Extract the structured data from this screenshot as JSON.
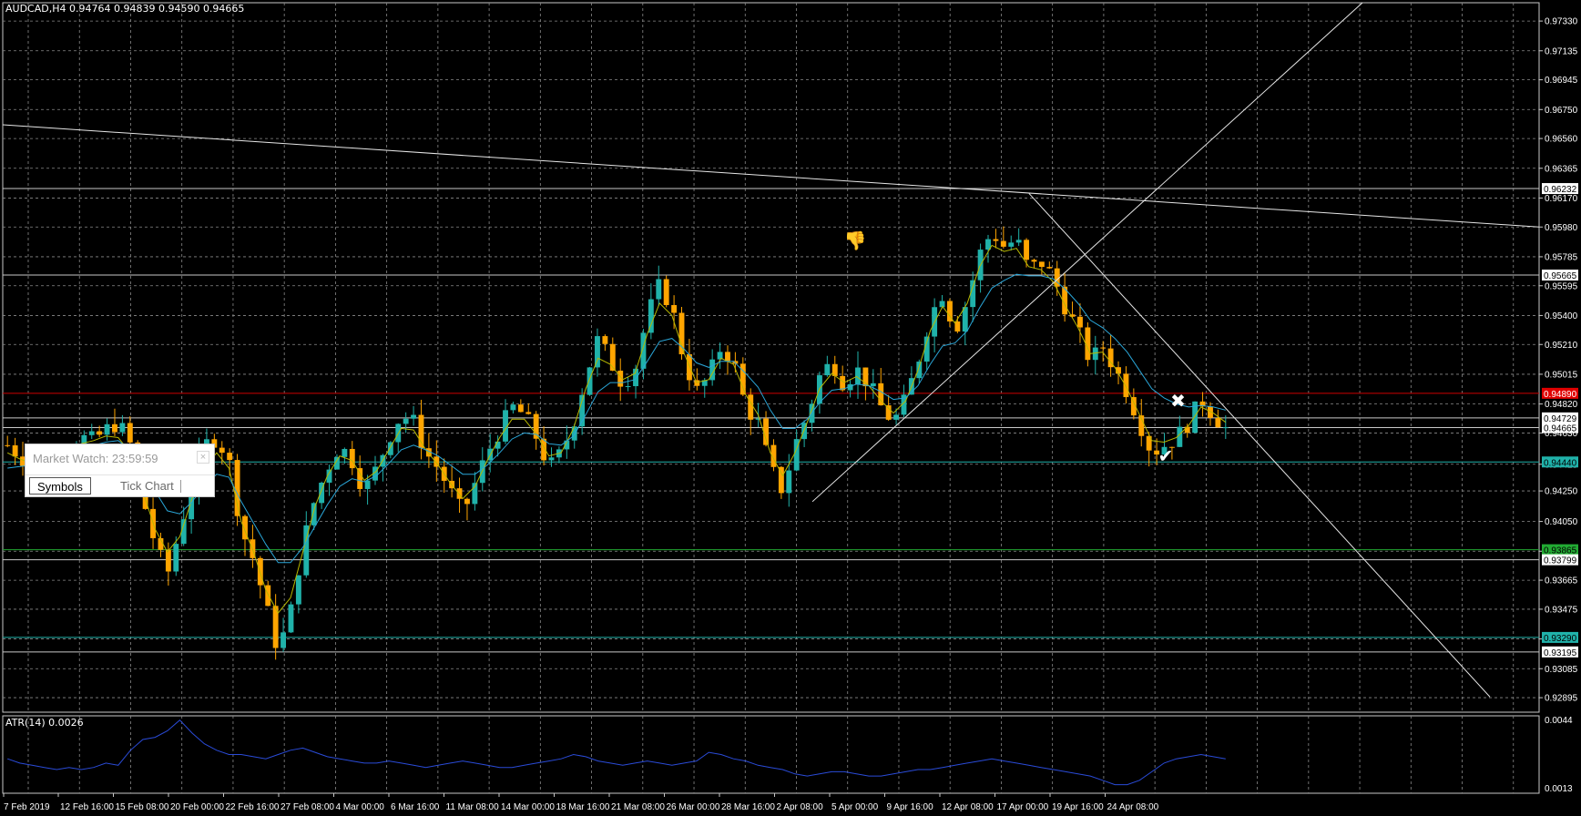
{
  "chart_header": {
    "symbol_info": "AUDCAD,H4  0.94764 0.94839 0.94590 0.94665"
  },
  "indicator": {
    "label": "ATR(14) 0.0026",
    "axis_labels": [
      "0.0044",
      "0.0013"
    ]
  },
  "market_watch": {
    "title": "Market Watch: 23:59:59",
    "close_glyph": "×",
    "tabs": [
      "Symbols",
      "Tick Chart"
    ],
    "active_tab": "Symbols"
  },
  "colors": {
    "background": "#000000",
    "grid": "#8a8a8a",
    "bull_candle": "#20b2aa",
    "bear_candle": "#ffa500",
    "ma_fast": "#b8b800",
    "ma_slow": "#2aa6d8",
    "atr_line": "#2a4bd8",
    "resistance_line": "#cc0000",
    "support_line": "#20b2aa",
    "green_level": "#22aa33"
  },
  "chart_data": {
    "type": "candlestick",
    "symbol": "AUDCAD",
    "timeframe": "H4",
    "ylim": [
      0.928,
      0.9745
    ],
    "price_ticks": [
      "0.97330",
      "0.97135",
      "0.96945",
      "0.96750",
      "0.96560",
      "0.96365",
      "0.96170",
      "0.95980",
      "0.95785",
      "0.95595",
      "0.95400",
      "0.95210",
      "0.95015",
      "0.94820",
      "0.94630",
      "0.94425",
      "0.94250",
      "0.94050",
      "0.93855",
      "0.93665",
      "0.93475",
      "0.93280",
      "0.93085",
      "0.92895"
    ],
    "time_labels": [
      "7 Feb 2019",
      "12 Feb 16:00",
      "15 Feb 08:00",
      "20 Feb 00:00",
      "22 Feb 16:00",
      "27 Feb 08:00",
      "4 Mar 00:00",
      "6 Mar 16:00",
      "11 Mar 08:00",
      "14 Mar 00:00",
      "18 Mar 16:00",
      "21 Mar 08:00",
      "26 Mar 00:00",
      "28 Mar 16:00",
      "2 Apr 08:00",
      "5 Apr 00:00",
      "9 Apr 16:00",
      "12 Apr 08:00",
      "17 Apr 00:00",
      "19 Apr 16:00",
      "24 Apr 08:00"
    ],
    "price_levels": [
      {
        "label": "0.96232",
        "value": 0.96232,
        "color": "#c8c8c8",
        "badge_bg": "#ffffff",
        "badge_fg": "#000000"
      },
      {
        "label": "0.95665",
        "value": 0.95665,
        "color": "#c8c8c8",
        "badge_bg": "#ffffff",
        "badge_fg": "#000000"
      },
      {
        "label": "0.94890",
        "value": 0.9489,
        "color": "#cc0000",
        "badge_bg": "#e00000",
        "badge_fg": "#ffffff"
      },
      {
        "label": "0.94729",
        "value": 0.94729,
        "color": "#c8c8c8",
        "badge_bg": "#ffffff",
        "badge_fg": "#000000"
      },
      {
        "label": "0.94665",
        "value": 0.94665,
        "color": "#c8c8c8",
        "badge_bg": "#ffffff",
        "badge_fg": "#000000"
      },
      {
        "label": "0.94440",
        "value": 0.9444,
        "color": "#20b2aa",
        "badge_bg": "#20b2aa",
        "badge_fg": "#000000"
      },
      {
        "label": "0.93865",
        "value": 0.93865,
        "color": "#22aa33",
        "badge_bg": "#22aa33",
        "badge_fg": "#000000"
      },
      {
        "label": "0.93799",
        "value": 0.93799,
        "color": "#c8c8c8",
        "badge_bg": "#ffffff",
        "badge_fg": "#000000"
      },
      {
        "label": "0.93290",
        "value": 0.9329,
        "color": "#20b2aa",
        "badge_bg": "#20b2aa",
        "badge_fg": "#000000"
      },
      {
        "label": "0.93195",
        "value": 0.93195,
        "color": "#c8c8c8",
        "badge_bg": "#ffffff",
        "badge_fg": "#000000"
      }
    ],
    "close_path": [
      0.9455,
      0.9448,
      0.9442,
      0.944,
      0.9445,
      0.9452,
      0.946,
      0.9458,
      0.9465,
      0.947,
      0.9455,
      0.942,
      0.939,
      0.937,
      0.94,
      0.943,
      0.9455,
      0.946,
      0.9445,
      0.94,
      0.938,
      0.935,
      0.932,
      0.9345,
      0.939,
      0.942,
      0.944,
      0.9455,
      0.9445,
      0.9425,
      0.944,
      0.946,
      0.9475,
      0.947,
      0.945,
      0.944,
      0.9425,
      0.941,
      0.943,
      0.945,
      0.9465,
      0.948,
      0.9475,
      0.946,
      0.944,
      0.945,
      0.947,
      0.95,
      0.9525,
      0.951,
      0.9495,
      0.9505,
      0.954,
      0.956,
      0.9545,
      0.951,
      0.949,
      0.95,
      0.952,
      0.951,
      0.948,
      0.947,
      0.944,
      0.9425,
      0.9455,
      0.9475,
      0.95,
      0.951,
      0.9495,
      0.9505,
      0.9495,
      0.948,
      0.947,
      0.9485,
      0.951,
      0.954,
      0.9555,
      0.953,
      0.955,
      0.958,
      0.9595,
      0.9585,
      0.959,
      0.957,
      0.9575,
      0.9565,
      0.9545,
      0.953,
      0.951,
      0.952,
      0.9505,
      0.949,
      0.947,
      0.945,
      0.9455,
      0.946,
      0.947,
      0.9485,
      0.9475,
      0.9466
    ],
    "ma_fast_path": [
      0.945,
      0.9446,
      0.9443,
      0.9444,
      0.9448,
      0.9452,
      0.9456,
      0.9458,
      0.9461,
      0.946,
      0.945,
      0.9425,
      0.94,
      0.9385,
      0.9395,
      0.942,
      0.944,
      0.945,
      0.944,
      0.9405,
      0.9385,
      0.936,
      0.9345,
      0.9355,
      0.9385,
      0.9415,
      0.9435,
      0.9448,
      0.9445,
      0.9432,
      0.9438,
      0.9452,
      0.9466,
      0.9465,
      0.9452,
      0.9442,
      0.943,
      0.942,
      0.9428,
      0.9445,
      0.946,
      0.9472,
      0.9472,
      0.9462,
      0.9448,
      0.945,
      0.9466,
      0.9492,
      0.9512,
      0.9508,
      0.9498,
      0.9502,
      0.9528,
      0.9548,
      0.954,
      0.9515,
      0.9496,
      0.9498,
      0.9512,
      0.9508,
      0.9488,
      0.9475,
      0.945,
      0.9435,
      0.945,
      0.947,
      0.9492,
      0.9502,
      0.9496,
      0.95,
      0.9494,
      0.9484,
      0.9476,
      0.9484,
      0.9504,
      0.953,
      0.9546,
      0.9535,
      0.9548,
      0.9572,
      0.9586,
      0.9582,
      0.9584,
      0.9572,
      0.957,
      0.9562,
      0.9546,
      0.9532,
      0.9515,
      0.9516,
      0.9506,
      0.9492,
      0.9475,
      0.9458,
      0.9457,
      0.946,
      0.9468,
      0.948,
      0.9476,
      0.947
    ],
    "ma_slow_path": [
      0.944,
      0.9441,
      0.9442,
      0.9444,
      0.9447,
      0.945,
      0.9453,
      0.9455,
      0.9457,
      0.9458,
      0.9452,
      0.944,
      0.9425,
      0.9412,
      0.941,
      0.9418,
      0.9428,
      0.9436,
      0.9434,
      0.9418,
      0.9404,
      0.939,
      0.9378,
      0.9378,
      0.9388,
      0.9402,
      0.9416,
      0.9428,
      0.9433,
      0.9431,
      0.9435,
      0.9443,
      0.9452,
      0.9455,
      0.9452,
      0.9448,
      0.9442,
      0.9436,
      0.9436,
      0.9442,
      0.945,
      0.9459,
      0.9463,
      0.9462,
      0.9456,
      0.9455,
      0.9461,
      0.9475,
      0.949,
      0.9496,
      0.9496,
      0.9498,
      0.951,
      0.9523,
      0.9525,
      0.9518,
      0.9509,
      0.9506,
      0.951,
      0.951,
      0.9502,
      0.9493,
      0.9478,
      0.9466,
      0.9466,
      0.9472,
      0.9483,
      0.9491,
      0.9492,
      0.9495,
      0.9494,
      0.949,
      0.9485,
      0.9486,
      0.9494,
      0.9508,
      0.952,
      0.9522,
      0.953,
      0.9545,
      0.9558,
      0.9563,
      0.9567,
      0.9566,
      0.9566,
      0.9564,
      0.9557,
      0.9548,
      0.9537,
      0.9532,
      0.9525,
      0.9516,
      0.9504,
      0.9492,
      0.9486,
      0.9482,
      0.948,
      0.9481,
      0.948,
      0.9478
    ],
    "atr_path": [
      0.0026,
      0.0024,
      0.0023,
      0.0022,
      0.0021,
      0.0022,
      0.0021,
      0.0022,
      0.0024,
      0.0023,
      0.003,
      0.0035,
      0.0036,
      0.0039,
      0.0044,
      0.0038,
      0.0033,
      0.003,
      0.0028,
      0.0028,
      0.0027,
      0.0026,
      0.0028,
      0.003,
      0.0031,
      0.0029,
      0.0027,
      0.0026,
      0.0025,
      0.0024,
      0.0024,
      0.0025,
      0.0024,
      0.0023,
      0.0022,
      0.0023,
      0.0024,
      0.0025,
      0.0024,
      0.0023,
      0.0022,
      0.0022,
      0.0023,
      0.0024,
      0.0025,
      0.0026,
      0.0028,
      0.0027,
      0.0025,
      0.0024,
      0.0023,
      0.0024,
      0.0025,
      0.0024,
      0.0023,
      0.0024,
      0.0025,
      0.0029,
      0.0028,
      0.0026,
      0.0025,
      0.0023,
      0.0022,
      0.0021,
      0.0019,
      0.0018,
      0.0019,
      0.002,
      0.002,
      0.0019,
      0.0018,
      0.0018,
      0.0019,
      0.002,
      0.0021,
      0.0021,
      0.0022,
      0.0023,
      0.0024,
      0.0025,
      0.0026,
      0.0025,
      0.0024,
      0.0023,
      0.0022,
      0.0021,
      0.002,
      0.0019,
      0.0018,
      0.0016,
      0.0014,
      0.0014,
      0.0016,
      0.002,
      0.0024,
      0.0026,
      0.0027,
      0.0028,
      0.0027,
      0.0026
    ],
    "atr_ylim": [
      0.001,
      0.0046
    ],
    "trendlines": [
      {
        "name": "long-resistance-line",
        "from": [
          0.0,
          0.9665
        ],
        "to": [
          1.0,
          0.9598
        ]
      },
      {
        "name": "rising-channel-line",
        "from": [
          0.527,
          0.9418
        ],
        "to": [
          0.885,
          0.9745
        ]
      },
      {
        "name": "falling-trend-line",
        "from": [
          0.668,
          0.962
        ],
        "to": [
          0.968,
          0.929
        ]
      }
    ],
    "signal_markers": [
      {
        "name": "sell-signal-x",
        "glyph": "✖",
        "at": [
          0.765,
          0.948
        ]
      },
      {
        "name": "buy-signal-check",
        "glyph": "✔",
        "at": [
          0.757,
          0.9444
        ]
      },
      {
        "name": "thumbs-down-signal",
        "glyph": "👎",
        "at": [
          0.555,
          0.9585
        ]
      }
    ]
  }
}
